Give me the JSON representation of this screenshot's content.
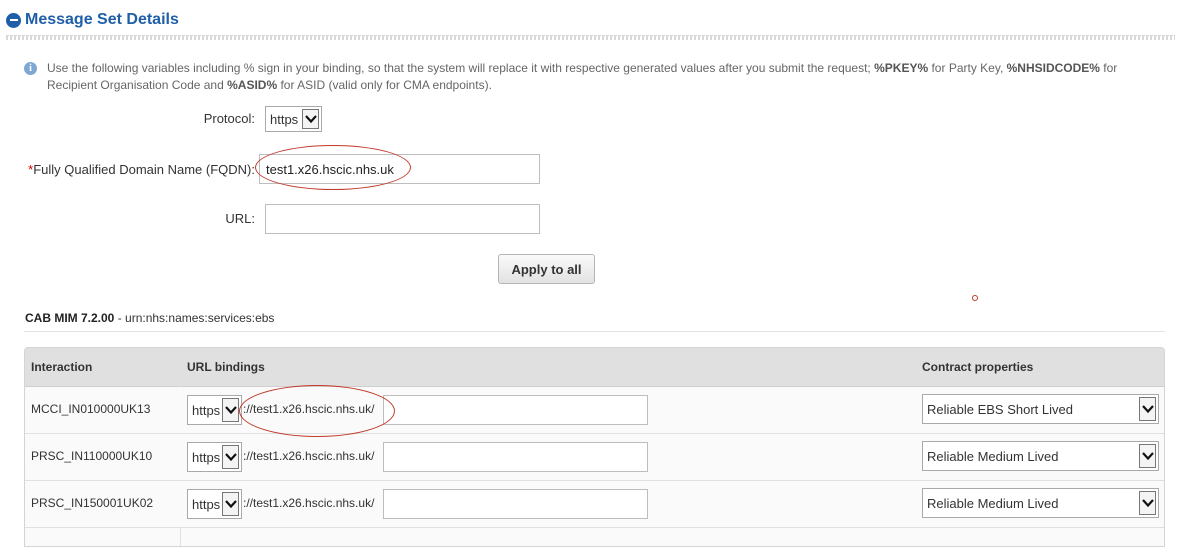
{
  "section": {
    "title": "Message Set Details"
  },
  "info": {
    "part1": "Use the following variables including % sign in your binding, so that the system will replace it with respective generated values after you submit the request; ",
    "pkey": "%PKEY%",
    "part2": " for Party Key, ",
    "nhsid": "%NHSIDCODE%",
    "part3": " for Recipient Organisation Code and ",
    "asid": "%ASID%",
    "part4": " for ASID (valid only for CMA endpoints)."
  },
  "form": {
    "protocol_label": "Protocol:",
    "protocol_value": "https",
    "fqdn_required_mark": "*",
    "fqdn_label": "Fully Qualified Domain Name (FQDN):",
    "fqdn_value": "test1.x26.hscic.nhs.uk",
    "url_label": "URL:",
    "url_value": "",
    "apply_button": "Apply to all"
  },
  "service": {
    "name": "CAB MIM 7.2.00",
    "separator": " - ",
    "urn": "urn:nhs:names:services:ebs"
  },
  "table": {
    "headers": {
      "interaction": "Interaction",
      "bindings": "URL bindings",
      "contract": "Contract properties"
    },
    "rows": [
      {
        "interaction": "MCCI_IN010000UK13",
        "protocol": "https",
        "fixed": "://test1.x26.hscic.nhs.uk/",
        "path": "",
        "contract": "Reliable EBS Short Lived"
      },
      {
        "interaction": "PRSC_IN110000UK10",
        "protocol": "https",
        "fixed": "://test1.x26.hscic.nhs.uk/",
        "path": "",
        "contract": "Reliable Medium Lived"
      },
      {
        "interaction": "PRSC_IN150001UK02",
        "protocol": "https",
        "fixed": "://test1.x26.hscic.nhs.uk/",
        "path": "",
        "contract": "Reliable Medium Lived"
      }
    ]
  },
  "colors": {
    "title": "#1f5fa8",
    "annotation": "#c0392b",
    "required": "#cc0000"
  }
}
